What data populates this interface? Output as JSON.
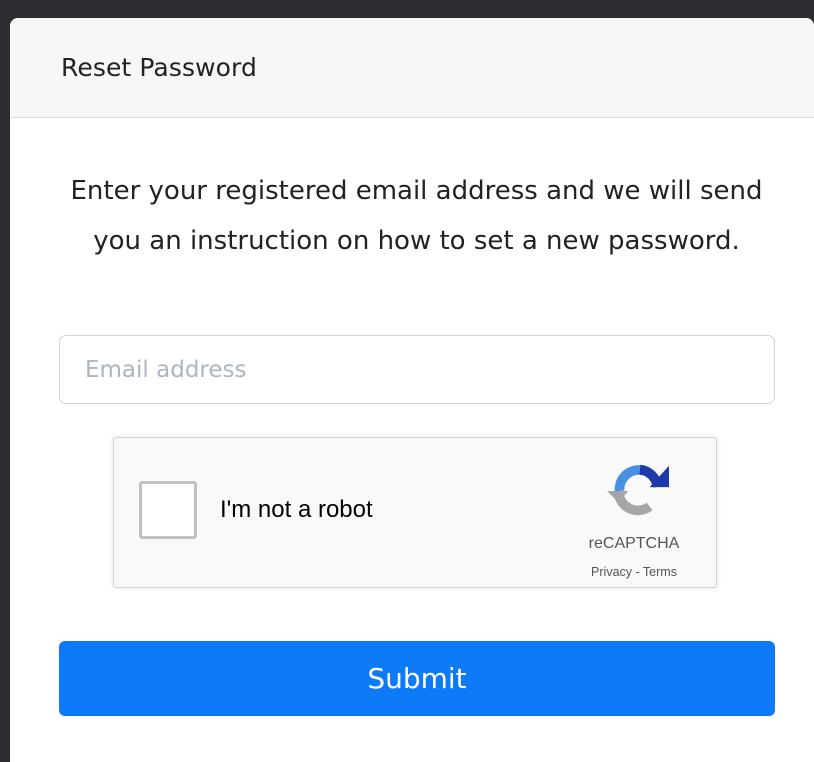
{
  "card": {
    "title": "Reset Password",
    "instruction": "Enter your registered email address and we will send you an instruction on how to set a new password."
  },
  "email": {
    "placeholder": "Email address",
    "value": ""
  },
  "recaptcha": {
    "checkbox_label": "I'm not a robot",
    "checked": false,
    "brand": "reCAPTCHA",
    "privacy_label": "Privacy",
    "separator": " - ",
    "terms_label": "Terms",
    "icon": "recaptcha-logo-icon"
  },
  "form": {
    "submit_label": "Submit"
  },
  "colors": {
    "primary": "#0d7bf8",
    "page_background": "#2b2d31",
    "header_background": "#f7f7f7"
  }
}
